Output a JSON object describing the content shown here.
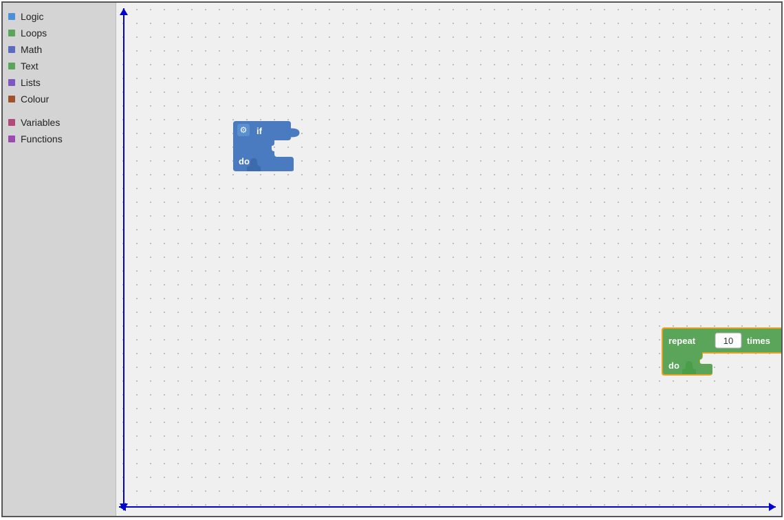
{
  "sidebar": {
    "items": [
      {
        "id": "logic",
        "label": "Logic",
        "color": "#4a90d9"
      },
      {
        "id": "loops",
        "label": "Loops",
        "color": "#5ba55b"
      },
      {
        "id": "math",
        "label": "Math",
        "color": "#5c6bc0"
      },
      {
        "id": "text",
        "label": "Text",
        "color": "#5ba55b"
      },
      {
        "id": "lists",
        "label": "Lists",
        "color": "#7e57c2"
      },
      {
        "id": "colour",
        "label": "Colour",
        "color": "#a0522d"
      },
      {
        "id": "variables",
        "label": "Variables",
        "color": "#b04a7a"
      },
      {
        "id": "functions",
        "label": "Functions",
        "color": "#9c4ab0"
      }
    ]
  },
  "blocks": {
    "if_block": {
      "if_label": "if",
      "do_label": "do"
    },
    "repeat_block": {
      "repeat_label": "repeat",
      "times_label": "times",
      "do_label": "do",
      "count_value": "10"
    }
  }
}
